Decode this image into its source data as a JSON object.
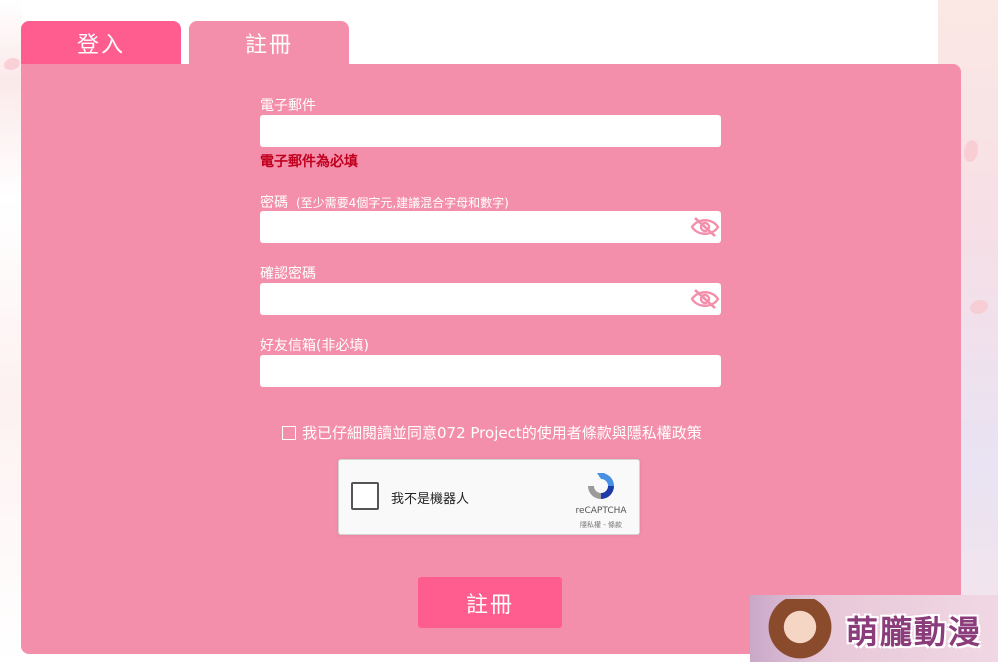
{
  "tabs": {
    "login_label": "登入",
    "register_label": "註冊"
  },
  "form": {
    "email_label": "電子郵件",
    "email_value": "",
    "email_error": "電子郵件為必填",
    "password_label": "密碼",
    "password_hint": "(至少需要4個字元,建議混合字母和數字)",
    "password_value": "",
    "confirm_label": "確認密碼",
    "confirm_value": "",
    "friend_label": "好友信箱(非必填)",
    "friend_value": "",
    "terms_label": "我已仔細閱讀並同意072 Project的使用者條款與隱私權政策",
    "submit_label": "註冊"
  },
  "recaptcha": {
    "label": "我不是機器人",
    "brand": "reCAPTCHA",
    "links": "隱私權 - 條款"
  },
  "watermark": {
    "text": "萌朧動漫"
  },
  "colors": {
    "accent": "#ff5d8f",
    "panel": "#f48fab",
    "error": "#c1001e"
  },
  "icons": {
    "password_toggle": "eye-slash-icon",
    "confirm_toggle": "eye-slash-icon",
    "recaptcha": "recaptcha-logo-icon"
  }
}
